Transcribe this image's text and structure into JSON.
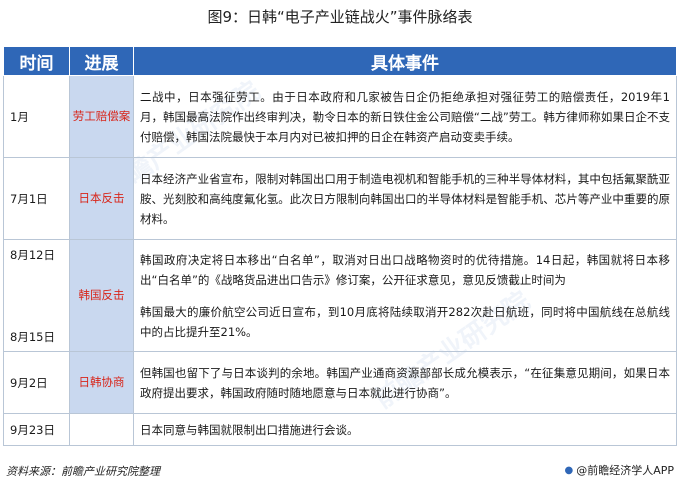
{
  "title": "图9：日韩“电子产业链战火”事件脉络表",
  "headers": {
    "time": "时间",
    "progress": "进展",
    "detail": "具体事件"
  },
  "rows": [
    {
      "time": "1月",
      "progress": "劳工赔偿案",
      "detail": "二战中，日本强征劳工。由于日本政府和几家被告日企仍拒绝承担对强征劳工的赔偿责任，2019年1月，韩国最高法院作出终审判决，勒令日本的新日铁住金公司赔偿“二战”劳工。韩方律师称如果日企不支付赔偿，韩国法院最快于本月内对已被扣押的日企在韩资产启动变卖手续。"
    },
    {
      "time": "7月1日",
      "progress": "日本反击",
      "detail": "日本经济产业省宣布，限制对韩国出口用于制造电视机和智能手机的三种半导体材料，其中包括氟聚酰亚胺、光刻胶和高纯度氟化氢。此次日方限制向韩国出口的半导体材料是智能手机、芯片等产业中重要的原材料。"
    },
    {
      "time": "8月12日",
      "time2": "8月15日",
      "progress": "韩国反击",
      "detail": "韩国政府决定将日本移出“白名单”，取消对日出口战略物资时的优待措施。14日起，韩国就将日本移出“白名单”的《战略货品进出口告示》修订案，公开征求意见，意见反馈截止时间为",
      "detail2": "韩国最大的廉价航空公司近日宣布，到10月底将陆续取消开282次赴日航班，同时将中国航线在总航线中的占比提升至21%。"
    },
    {
      "time": "9月2日",
      "progress": "日韩协商",
      "detail": "但韩国也留下了与日本谈判的余地。韩国产业通商资源部部长成允模表示，“在征集意见期间，如果日本政府提出要求，韩国政府随时随地愿意与日本就此进行协商”。"
    },
    {
      "time": "9月23日",
      "progress": "",
      "detail": "日本同意与韩国就限制出口措施进行会谈。"
    }
  ],
  "source": "资料来源：前瞻产业研究院整理",
  "brand": "@前瞻经济学人APP",
  "watermark": "前瞻产业研究院",
  "colors": {
    "header_bg": "#2f67b7",
    "progress_bg": "#c9d8ef",
    "progress_text": "#d8261b"
  }
}
